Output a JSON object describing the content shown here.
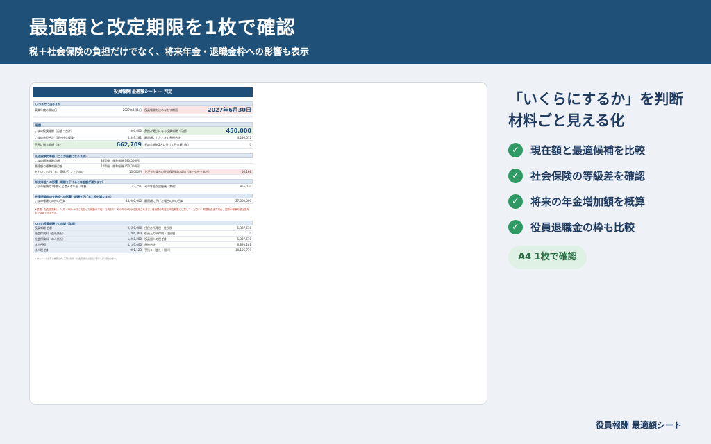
{
  "header": {
    "title": "最適額と改定期限を1枚で確認",
    "subtitle": "税＋社会保険の負担だけでなく、将来年金・退職金枠への影響も表示"
  },
  "sheet": {
    "title": "役員報酬 最適額シート ― 判定",
    "sec1": "いつまでに決めるか",
    "r1": [
      "事業年度の開始日",
      "2027年4月1日",
      "役員報酬を決めなおす期限",
      "2027年6月30日"
    ],
    "sec2": "税額",
    "r2": [
      "いまの役員報酬（月額・合計）",
      "800,000",
      "負担が最小になる役員報酬（月額）",
      "450,000"
    ],
    "r3": [
      "いまの負担合計（税＋社会保険）",
      "6,893,281",
      "最適額にしたときの負担合計",
      "4,230,572"
    ],
    "r4": [
      "手元に残る差額（年）",
      "662,709",
      "その差額を2人に分けて残る額（年）",
      "0"
    ],
    "sec3": "社会保険の等級（ここが段差になります）",
    "r5": [
      "いまの標準報酬月額",
      "35等級（標準報酬 790,000円）"
    ],
    "r6": [
      "最適額の標準報酬月額",
      "12等級（標準報酬 450,000円）"
    ],
    "r7": [
      "あといくら上げると等級が1つ上がるか",
      "10,000円",
      "上がった場合の社会保険料の増加（年・会社＋本人）",
      "56,168"
    ],
    "sec4": "将来年金への影響（報酬を下げると年金額が減ります）",
    "r8": [
      "いまの報酬で1年働くと増える年金（年額）",
      "42,751",
      "その年金が受給後（累積）",
      "855,020"
    ],
    "sec5": "役員退職金の支給枠への影響（報酬を下げると枠も減ります）",
    "r9": [
      "いまの報酬での枠の目安",
      "48,000,000",
      "最適額に下げた場合の枠の目安",
      "27,000,000"
    ],
    "warn": "★重要：社会保険料は「4月・5月・6月に支払った報酬の平均」で決まり、その年の9月から適用されます。最適額の判定と申告期限に注意してください。期限を過ぎた場合、実際の報酬月額は翌年まで変更できません。",
    "sec6": "いまの役員報酬での内訳（年額）",
    "t": [
      [
        "役員報酬 合計",
        "9,600,000",
        "住民の所得税・住民税",
        "1,337,518"
      ],
      [
        "社会保険料（会社負担）",
        "1,286,360",
        "役員上の所得税・住民税",
        "0"
      ],
      [
        "社会保険料（本人負担）",
        "1,268,280",
        "役員個人の税 合計",
        "1,337,518"
      ],
      [
        "法人所得",
        "4,103,000",
        "負担合計",
        "6,893,281"
      ],
      [
        "法人税 合計",
        "991,123",
        "手残り（会社＋個人）",
        "10,106,719"
      ]
    ],
    "notes": "※ 本シートの計算は概算です。実際の税額・社会保険料は個別の事情により異なります。"
  },
  "right": {
    "title": "「いくらにするか」を判断材料ごと見える化",
    "features": [
      "現在額と最適候補を比較",
      "社会保険の等級差を確認",
      "将来の年金増加額を概算",
      "役員退職金の枠も比較"
    ],
    "check_icon": "✓",
    "badge": "A4 1枚で確認"
  },
  "footer": "役員報酬 最適額シート",
  "colors": {
    "header": "#1f5078",
    "accent": "#2f9a63",
    "text": "#1e3a5f"
  }
}
